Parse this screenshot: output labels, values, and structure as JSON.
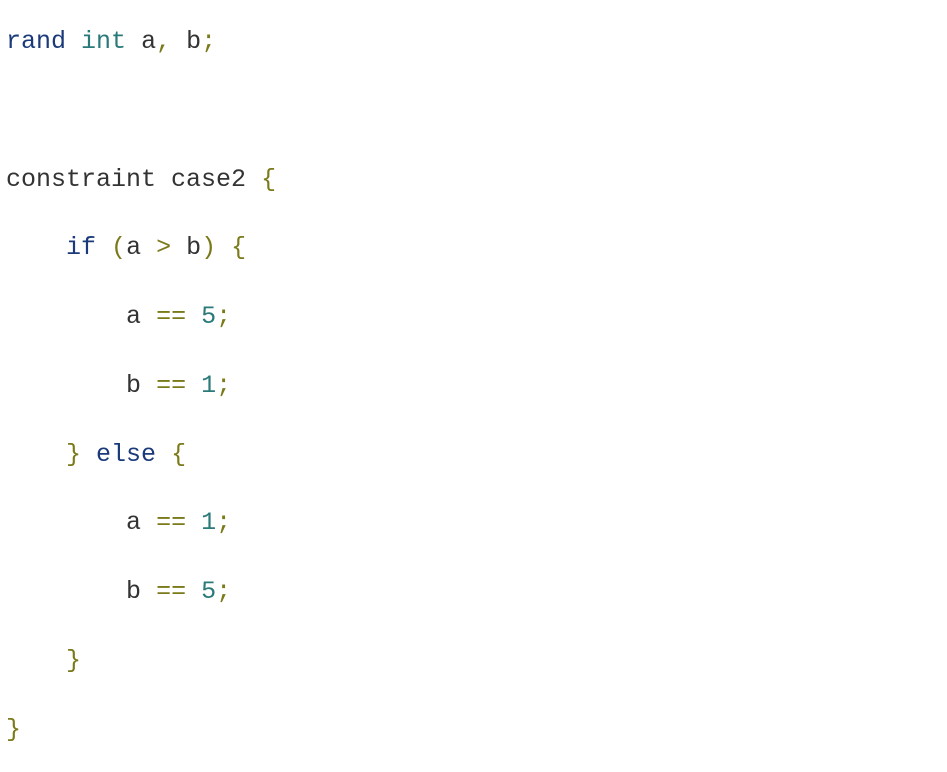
{
  "code": {
    "line1": {
      "keyword": "rand",
      "type": "int",
      "var_a": "a",
      "comma": ",",
      "var_b": "b",
      "semi": ";"
    },
    "line3": {
      "keyword": "constraint",
      "name": "case2",
      "brace": "{"
    },
    "line4": {
      "indent": "    ",
      "keyword": "if",
      "open_paren": "(",
      "var_a": "a",
      "greater": ">",
      "var_b": "b",
      "close_paren": ")",
      "brace": "{"
    },
    "line5": {
      "indent": "        ",
      "var": "a",
      "eq": "==",
      "num": "5",
      "semi": ";"
    },
    "line6": {
      "indent": "        ",
      "var": "b",
      "eq": "==",
      "num": "1",
      "semi": ";"
    },
    "line7": {
      "indent": "    ",
      "close_brace": "}",
      "keyword": "else",
      "open_brace": "{"
    },
    "line8": {
      "indent": "        ",
      "var": "a",
      "eq": "==",
      "num": "1",
      "semi": ";"
    },
    "line9": {
      "indent": "        ",
      "var": "b",
      "eq": "==",
      "num": "5",
      "semi": ";"
    },
    "line10": {
      "indent": "    ",
      "brace": "}"
    },
    "line11": {
      "brace": "}"
    }
  }
}
